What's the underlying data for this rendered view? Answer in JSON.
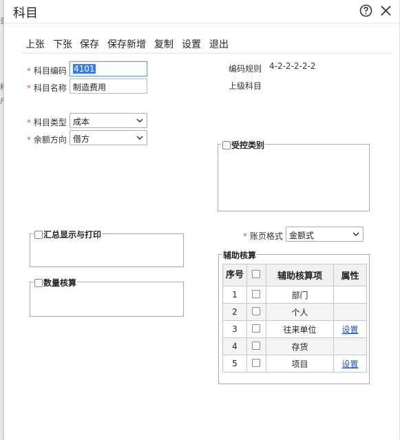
{
  "background": {
    "fragments": [
      "录",
      "科",
      "户"
    ]
  },
  "window": {
    "title": "科目"
  },
  "toolbar": [
    "上张",
    "下张",
    "保存",
    "保存新增",
    "复制",
    "设置",
    "退出"
  ],
  "required_mark": "*",
  "form": {
    "code": {
      "label": "科目编码",
      "value": "4101"
    },
    "name": {
      "label": "科目名称",
      "value": "制造费用"
    },
    "type": {
      "label": "科目类型",
      "value": "成本"
    },
    "balance": {
      "label": "余额方向",
      "value": "借方"
    },
    "code_rule": {
      "label": "编码规则",
      "value": "4-2-2-2-2-2"
    },
    "parent": {
      "label": "上级科目",
      "value": ""
    },
    "ledger_format": {
      "label": "账页格式",
      "value": "金额式"
    }
  },
  "groups": {
    "controlled": "受控类别",
    "summary": "汇总显示与打印",
    "quantity": "数量核算",
    "auxiliary": "辅助核算"
  },
  "aux_table": {
    "headers": {
      "no": "序号",
      "item": "辅助核算项",
      "attr": "属性"
    },
    "rows": [
      {
        "no": "1",
        "item": "部门",
        "attr": ""
      },
      {
        "no": "2",
        "item": "个人",
        "attr": ""
      },
      {
        "no": "3",
        "item": "往来单位",
        "attr": "设置"
      },
      {
        "no": "4",
        "item": "存货",
        "attr": ""
      },
      {
        "no": "5",
        "item": "项目",
        "attr": "设置"
      }
    ]
  },
  "colors": {
    "accent": "#3b7ddd",
    "required": "#d9534f",
    "link": "#1a4fb5"
  }
}
